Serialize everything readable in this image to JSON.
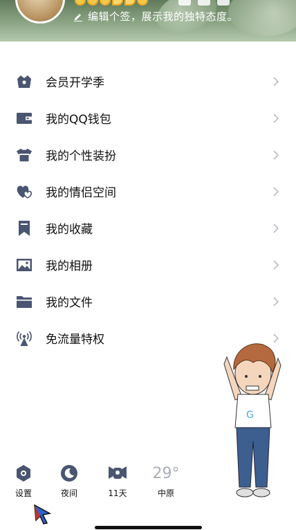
{
  "header": {
    "signature": "编辑个签，展示我的独特态度。"
  },
  "menu": {
    "items": [
      {
        "label": "会员开学季",
        "icon": "vip-shop-icon"
      },
      {
        "label": "我的QQ钱包",
        "icon": "wallet-icon"
      },
      {
        "label": "我的个性装扮",
        "icon": "tshirt-icon"
      },
      {
        "label": "我的情侣空间",
        "icon": "hearts-icon"
      },
      {
        "label": "我的收藏",
        "icon": "bookmark-icon"
      },
      {
        "label": "我的相册",
        "icon": "photo-icon"
      },
      {
        "label": "我的文件",
        "icon": "folder-icon"
      },
      {
        "label": "免流量特权",
        "icon": "antenna-icon"
      }
    ]
  },
  "footer": {
    "settings_label": "设置",
    "night_label": "夜间",
    "checkin_label": "11天",
    "temperature": "29°",
    "city": "中原"
  },
  "colors": {
    "icon": "#4a5571",
    "chevron": "#b9bcc4",
    "text": "#111111",
    "footer_temp": "#a9adb6"
  }
}
